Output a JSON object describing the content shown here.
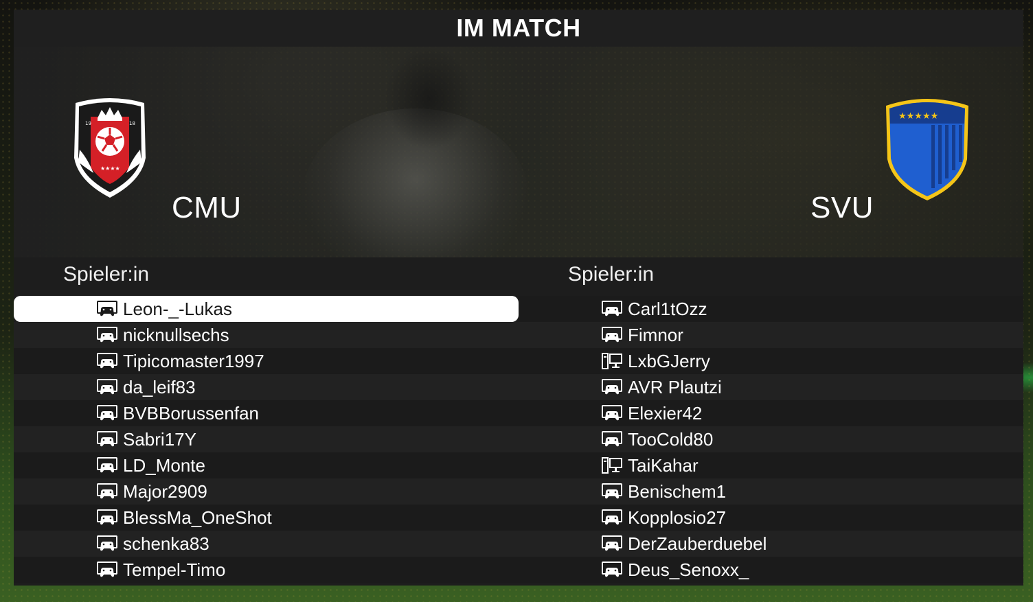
{
  "header": {
    "title": "IM MATCH"
  },
  "teams": {
    "home": {
      "name": "CMU",
      "crest_icon": "red-crowned-football-crest-icon",
      "crest_colors": [
        "#d42027",
        "#1a1a1a",
        "#ffffff"
      ]
    },
    "away": {
      "name": "SVU",
      "crest_icon": "blue-starred-shield-crest-icon",
      "crest_colors": [
        "#1f5fd0",
        "#f5c518"
      ]
    }
  },
  "rosters": {
    "home": {
      "header": "Spieler:in",
      "players": [
        {
          "name": "Leon-_-Lukas",
          "platform_icon": "console-controller-icon",
          "selected": true
        },
        {
          "name": "nicknullsechs",
          "platform_icon": "console-controller-icon"
        },
        {
          "name": "Tipicomaster1997",
          "platform_icon": "console-controller-icon"
        },
        {
          "name": "da_leif83",
          "platform_icon": "console-controller-icon"
        },
        {
          "name": "BVBBorussenfan",
          "platform_icon": "console-controller-icon"
        },
        {
          "name": "Sabri17Y",
          "platform_icon": "console-controller-icon"
        },
        {
          "name": "LD_Monte",
          "platform_icon": "console-controller-icon"
        },
        {
          "name": "Major2909",
          "platform_icon": "console-controller-icon"
        },
        {
          "name": "BlessMa_OneShot",
          "platform_icon": "console-controller-icon"
        },
        {
          "name": "schenka83",
          "platform_icon": "console-controller-icon"
        },
        {
          "name": "Tempel-Timo",
          "platform_icon": "console-controller-icon"
        }
      ]
    },
    "away": {
      "header": "Spieler:in",
      "players": [
        {
          "name": "Carl1tOzz",
          "platform_icon": "console-controller-icon"
        },
        {
          "name": "Fimnor",
          "platform_icon": "console-controller-icon"
        },
        {
          "name": "LxbGJerry",
          "platform_icon": "pc-desktop-icon"
        },
        {
          "name": "AVR Plautzi",
          "platform_icon": "console-controller-icon"
        },
        {
          "name": "Elexier42",
          "platform_icon": "console-controller-icon"
        },
        {
          "name": "TooCold80",
          "platform_icon": "console-controller-icon"
        },
        {
          "name": "TaiKahar",
          "platform_icon": "pc-desktop-icon"
        },
        {
          "name": "Benischem1",
          "platform_icon": "console-controller-icon"
        },
        {
          "name": "Kopplosio27",
          "platform_icon": "console-controller-icon"
        },
        {
          "name": "DerZauberduebel",
          "platform_icon": "console-controller-icon"
        },
        {
          "name": "Deus_Senoxx_",
          "platform_icon": "console-controller-icon"
        }
      ]
    }
  }
}
